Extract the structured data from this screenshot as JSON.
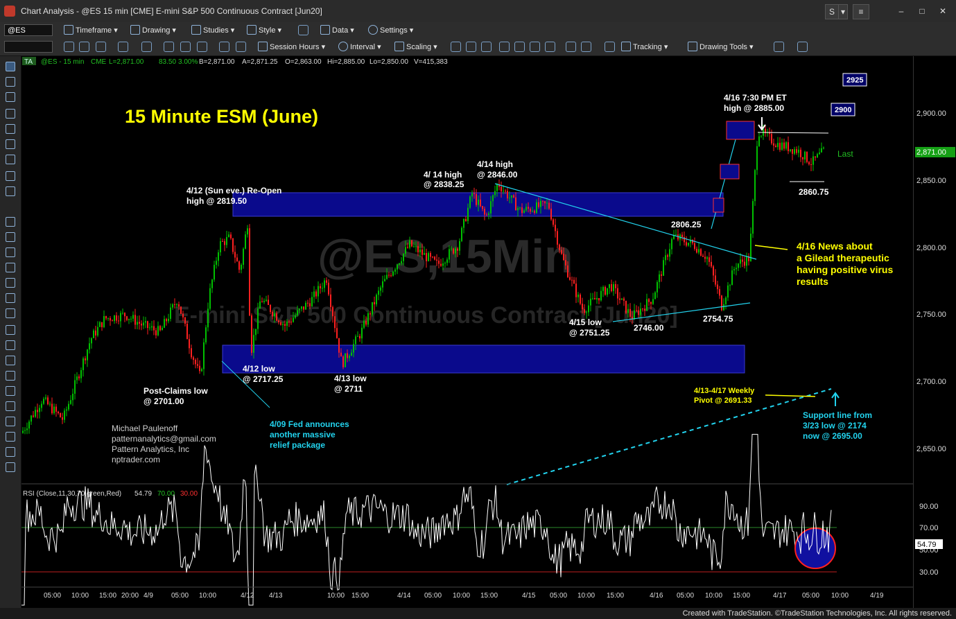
{
  "window": {
    "title": "Chart Analysis - @ES 15 min [CME] E-mini S&P 500 Continuous Contract [Jun20]",
    "s_button": "S",
    "dropdown_button": "▾",
    "menu_button": "≡",
    "minimize": "–",
    "maximize": "□",
    "close": "✕"
  },
  "toolbar1": {
    "symbol": "@ES",
    "timeframe": "Timeframe",
    "drawing": "Drawing",
    "studies": "Studies",
    "style": "Style",
    "data": "Data",
    "settings": "Settings"
  },
  "toolbar2": {
    "session_hours": "Session Hours",
    "interval": "Interval",
    "scaling": "Scaling",
    "tracking": "Tracking",
    "drawing_tools": "Drawing Tools"
  },
  "header": {
    "badge": "TA",
    "symbol_line": "@ES - 15 min",
    "exchange": "CME",
    "last": "L=2,871.00",
    "change": "83.50",
    "pct": "3.00%",
    "bid": "B=2,871.00",
    "ask": "A=2,871.25",
    "open": "O=2,863.00",
    "high": "Hi=2,885.00",
    "low": "Lo=2,850.00",
    "volume": "V=415,383"
  },
  "watermark": {
    "symbol": "@ES,15Min",
    "contract": "E-mini S&P 500 Continuous Contract [Jun20]"
  },
  "annotations": {
    "main_title": "15 Minute ESM (June)",
    "reopen": [
      "4/12 (Sun eve.) Re-Open",
      "high @ 2819.50"
    ],
    "high_414a": [
      "4/ 14 high",
      "@ 2838.25"
    ],
    "high_414b": [
      "4/14 high",
      "@ 2846.00"
    ],
    "high_416": [
      "4/16 7:30 PM ET",
      "high @ 2885.00"
    ],
    "low_412": [
      "4/12 low",
      "@ 2717.25"
    ],
    "low_413": [
      "4/13 low",
      "@ 2711"
    ],
    "post_claims": [
      "Post-Claims low",
      "@ 2701.00"
    ],
    "low_415": [
      "4/15 low",
      "@ 2751.25"
    ],
    "l2746": "2746.00",
    "l2754": "2754.75",
    "l2806": "2806.25",
    "l2860": "2860.75",
    "fed": [
      "4/09 Fed announces",
      "another massive",
      "relief package"
    ],
    "news": [
      "4/16 News about",
      "a Gilead therapeutic",
      "having positive virus",
      "results"
    ],
    "pivot": [
      "4/13-4/17 Weekly",
      "Pivot @ 2691.33"
    ],
    "support": [
      "Support line from",
      "3/23 low @ 2174",
      "now @ 2695.00"
    ],
    "author": [
      "Michael Paulenoff",
      "patternanalytics@gmail.com",
      "Pattern Analytics, Inc",
      "nptrader.com"
    ],
    "box_2925": "2925",
    "box_2900": "2900",
    "last_label": "Last"
  },
  "price_axis": {
    "ticks": [
      "2,900.00",
      "2,850.00",
      "2,800.00",
      "2,750.00",
      "2,700.00",
      "2,650.00"
    ],
    "last_price": "2,871.00"
  },
  "rsi": {
    "label": "RSI (Close,11,30,70,green,Red)",
    "value": "54.79",
    "ob": "70.00",
    "os": "30.00",
    "ticks": [
      "90.00",
      "70.00",
      "50.00",
      "30.00"
    ],
    "last_value": "54.79"
  },
  "time_axis": [
    "05:00",
    "10:00",
    "15:00",
    "20:00",
    "4/9",
    "05:00",
    "10:00",
    "4/12",
    "4/13",
    "10:00",
    "15:00",
    "4/14",
    "05:00",
    "10:00",
    "15:00",
    "4/15",
    "05:00",
    "10:00",
    "15:00",
    "4/16",
    "05:00",
    "10:00",
    "15:00",
    "4/17",
    "05:00",
    "10:00",
    "4/19"
  ],
  "footer": "Created with TradeStation. ©TradeStation Technologies, Inc. All rights reserved.",
  "colors": {
    "up": "#00c000",
    "down": "#ff2020",
    "zone": "#0a0a8c",
    "title": "#ffff00",
    "cyan": "#22d3ee",
    "rsi": "#ffffff"
  }
}
